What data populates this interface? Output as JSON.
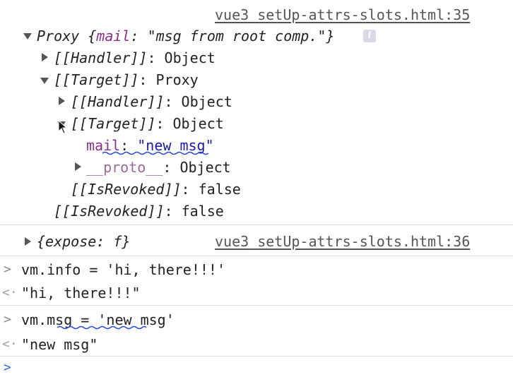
{
  "console": {
    "entry1": {
      "source": "vue3_setUp-attrs-slots.html:35",
      "summary_prefix": "Proxy {",
      "summary_key": "mail",
      "summary_sep": ": ",
      "summary_value": "\"msg from root comp.\"",
      "summary_suffix": "}",
      "info_icon": "i",
      "rows": {
        "handler1_key": "[[Handler]]",
        "handler1_val": ": Object",
        "target1_key": "[[Target]]",
        "target1_val": ": Proxy",
        "handler2_key": "[[Handler]]",
        "handler2_val": ": Object",
        "target2_key": "[[Target]]",
        "target2_val": ": Object",
        "mail_key": "mail",
        "mail_sep": ": ",
        "mail_val": "\"new msg\"",
        "proto_key": "__proto__",
        "proto_val": ": Object",
        "revoked1_key": "[[IsRevoked]]",
        "revoked1_val": ": false",
        "revoked2_key": "[[IsRevoked]]",
        "revoked2_val": ": false"
      }
    },
    "entry2": {
      "summary": "{expose: f}",
      "source": "vue3_setUp-attrs-slots.html:36"
    },
    "input1": {
      "command": "vm.info = 'hi, there!!!'",
      "result": "\"hi, there!!!\""
    },
    "input2": {
      "command": "vm.msg = 'new msg'",
      "result": "\"new msg\""
    },
    "prompt_symbol": ">",
    "return_symbol": "<·"
  },
  "colors": {
    "annotation_blue": "#2a4bd7",
    "link_gray": "#555555",
    "key_purple": "#8a2f8a"
  },
  "icons": {
    "expand": "triangle-down-icon",
    "collapse": "triangle-right-icon",
    "info": "info-icon",
    "cursor": "mouse-pointer-icon"
  }
}
